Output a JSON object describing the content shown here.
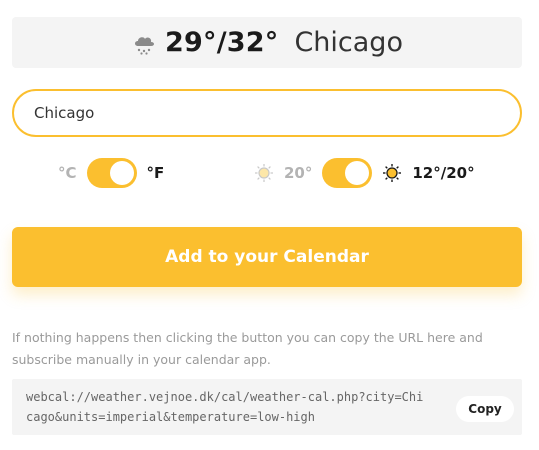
{
  "header": {
    "icon": "cloud-snow-icon",
    "temperature": "29°/32°",
    "city": "Chicago"
  },
  "search": {
    "value": "Chicago"
  },
  "units_toggle": {
    "left_label": "°C",
    "right_label": "°F",
    "selected": "right"
  },
  "temperature_toggle": {
    "left_icon": "sun-icon",
    "left_label": "20°",
    "right_icon": "sun-icon",
    "right_label": "12°/20°",
    "selected": "right"
  },
  "cta": {
    "label": "Add to your Calendar"
  },
  "hint": {
    "text": "If nothing happens then clicking the button you can copy the URL here and subscribe manually in your calendar app."
  },
  "url_box": {
    "url": "webcal://weather.vejnoe.dk/cal/weather-cal.php?city=Chicago&units=imperial&temperature=low-high",
    "copy_label": "Copy"
  },
  "colors": {
    "accent": "#fbbf2f",
    "panel_bg": "#f4f4f4",
    "muted_text": "#9a9a9a"
  }
}
